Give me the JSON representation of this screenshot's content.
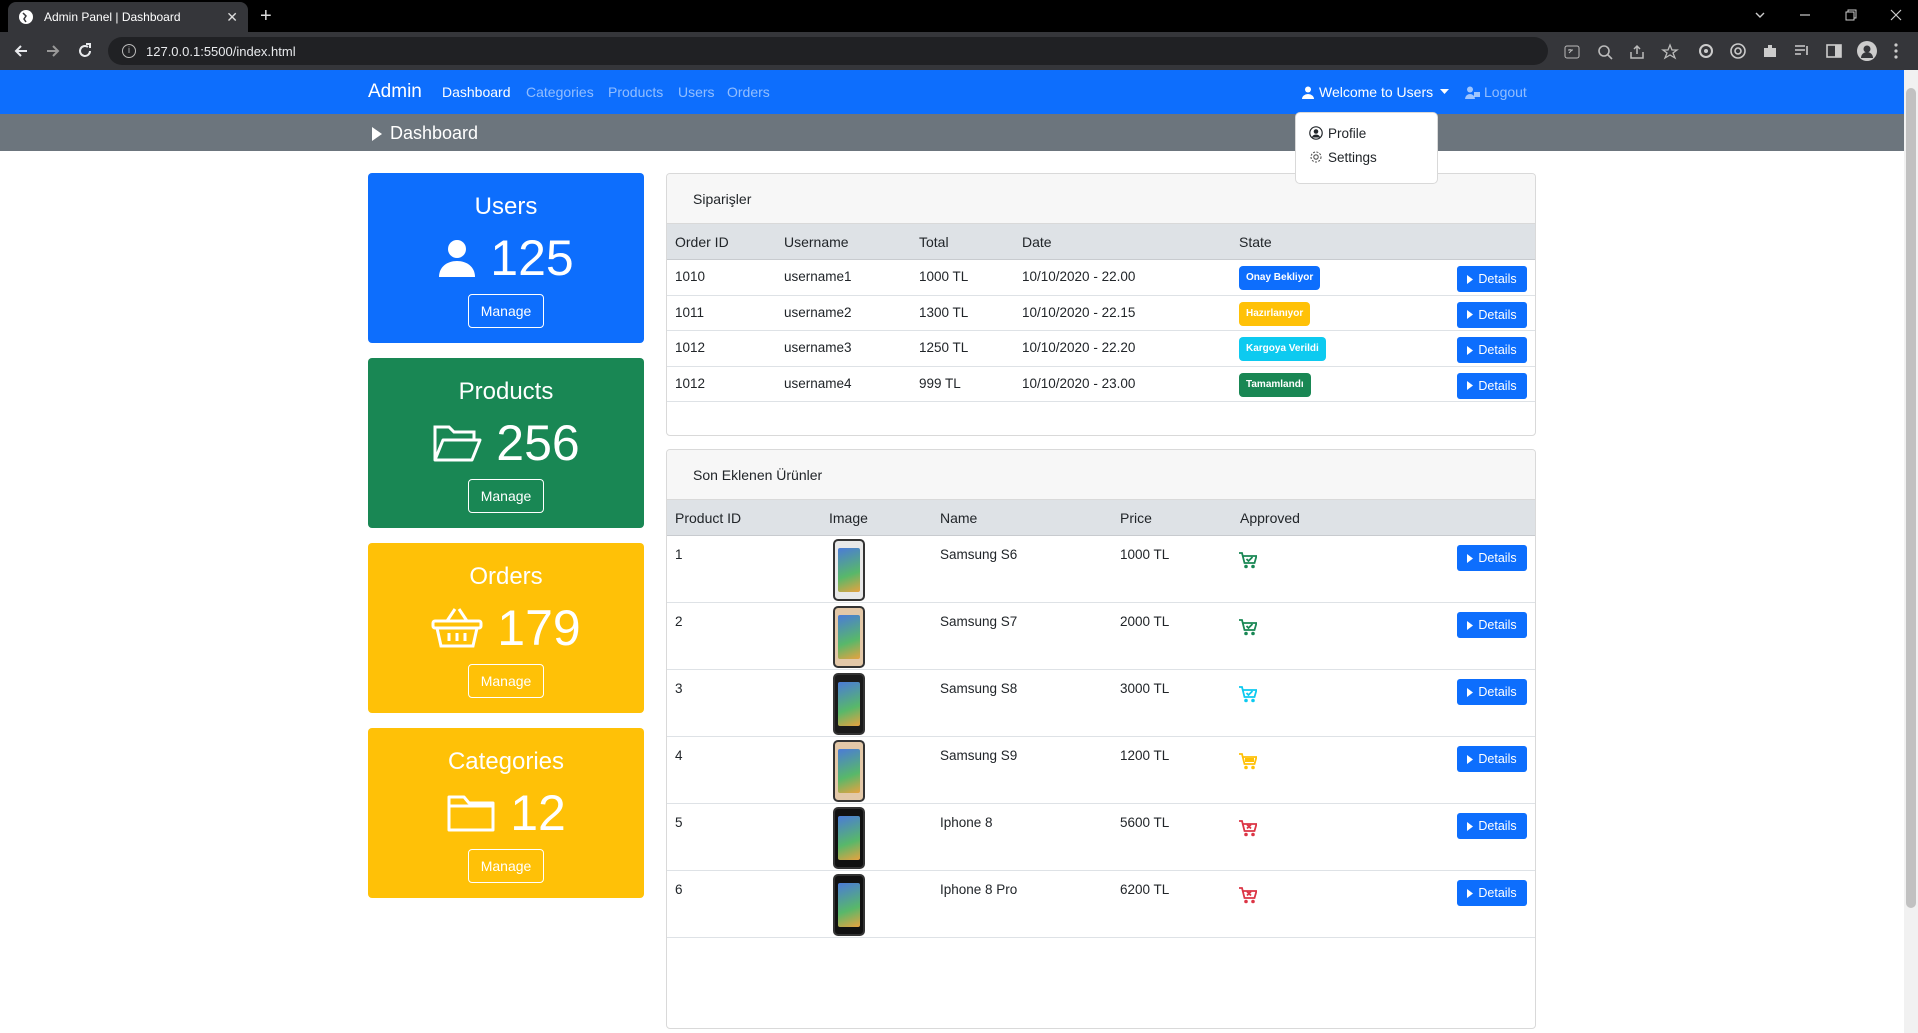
{
  "browser": {
    "tab_title": "Admin Panel | Dashboard",
    "tab_close": "✕",
    "new_tab": "+",
    "url": "127.0.0.1:5500/index.html"
  },
  "navbar": {
    "brand": "Admin",
    "links": [
      "Dashboard",
      "Categories",
      "Products",
      "Users",
      "Orders"
    ],
    "active_link": "Dashboard",
    "welcome": "Welcome to Users",
    "logout": "Logout"
  },
  "dropdown": {
    "items": [
      "Profile",
      "Settings"
    ]
  },
  "page": {
    "title": "Dashboard"
  },
  "stats": [
    {
      "title": "Users",
      "count": "125",
      "button": "Manage",
      "color": "#0d6efd",
      "icon": "user-icon"
    },
    {
      "title": "Products",
      "count": "256",
      "button": "Manage",
      "color": "#198754",
      "icon": "folder-open-icon"
    },
    {
      "title": "Orders",
      "count": "179",
      "button": "Manage",
      "color": "#ffc107",
      "icon": "basket-icon"
    },
    {
      "title": "Categories",
      "count": "12",
      "button": "Manage",
      "color": "#ffc107",
      "icon": "folder-icon"
    }
  ],
  "orders": {
    "header": "Siparişler",
    "columns": [
      "Order ID",
      "Username",
      "Total",
      "Date",
      "State"
    ],
    "rows": [
      {
        "id": "1010",
        "username": "username1",
        "total": "1000 TL",
        "date": "10/10/2020 - 22.00",
        "state": "Onay Bekliyor",
        "state_color": "#0d6efd",
        "action": "Details"
      },
      {
        "id": "1011",
        "username": "username2",
        "total": "1300 TL",
        "date": "10/10/2020 - 22.15",
        "state": "Hazırlanıyor",
        "state_color": "#ffc107",
        "action": "Details"
      },
      {
        "id": "1012",
        "username": "username3",
        "total": "1250 TL",
        "date": "10/10/2020 - 22.20",
        "state": "Kargoya Verildi",
        "state_color": "#0dcaf0",
        "action": "Details"
      },
      {
        "id": "1012",
        "username": "username4",
        "total": "999 TL",
        "date": "10/10/2020 - 23.00",
        "state": "Tamamlandı",
        "state_color": "#198754",
        "action": "Details"
      }
    ]
  },
  "products": {
    "header": "Son Eklenen Ürünler",
    "columns": [
      "Product ID",
      "Image",
      "Name",
      "Price",
      "Approved"
    ],
    "rows": [
      {
        "id": "1",
        "name": "Samsung S6",
        "price": "1000 TL",
        "approved_color": "#198754",
        "approved_icon": "cart-check-icon",
        "phone_color": "#e8e8e8",
        "action": "Details"
      },
      {
        "id": "2",
        "name": "Samsung S7",
        "price": "2000 TL",
        "approved_color": "#198754",
        "approved_icon": "cart-check-icon",
        "phone_color": "#e3c8a8",
        "action": "Details"
      },
      {
        "id": "3",
        "name": "Samsung S8",
        "price": "3000 TL",
        "approved_color": "#0dcaf0",
        "approved_icon": "cart-check-icon",
        "phone_color": "#1a1a1a",
        "action": "Details"
      },
      {
        "id": "4",
        "name": "Samsung S9",
        "price": "1200 TL",
        "approved_color": "#ffc107",
        "approved_icon": "cart-icon",
        "phone_color": "#e3c8a8",
        "action": "Details"
      },
      {
        "id": "5",
        "name": "Iphone 8",
        "price": "5600 TL",
        "approved_color": "#dc3545",
        "approved_icon": "cart-x-icon",
        "phone_color": "#111111",
        "action": "Details"
      },
      {
        "id": "6",
        "name": "Iphone 8 Pro",
        "price": "6200 TL",
        "approved_color": "#dc3545",
        "approved_icon": "cart-x-icon",
        "phone_color": "#111111",
        "action": "Details"
      }
    ]
  }
}
